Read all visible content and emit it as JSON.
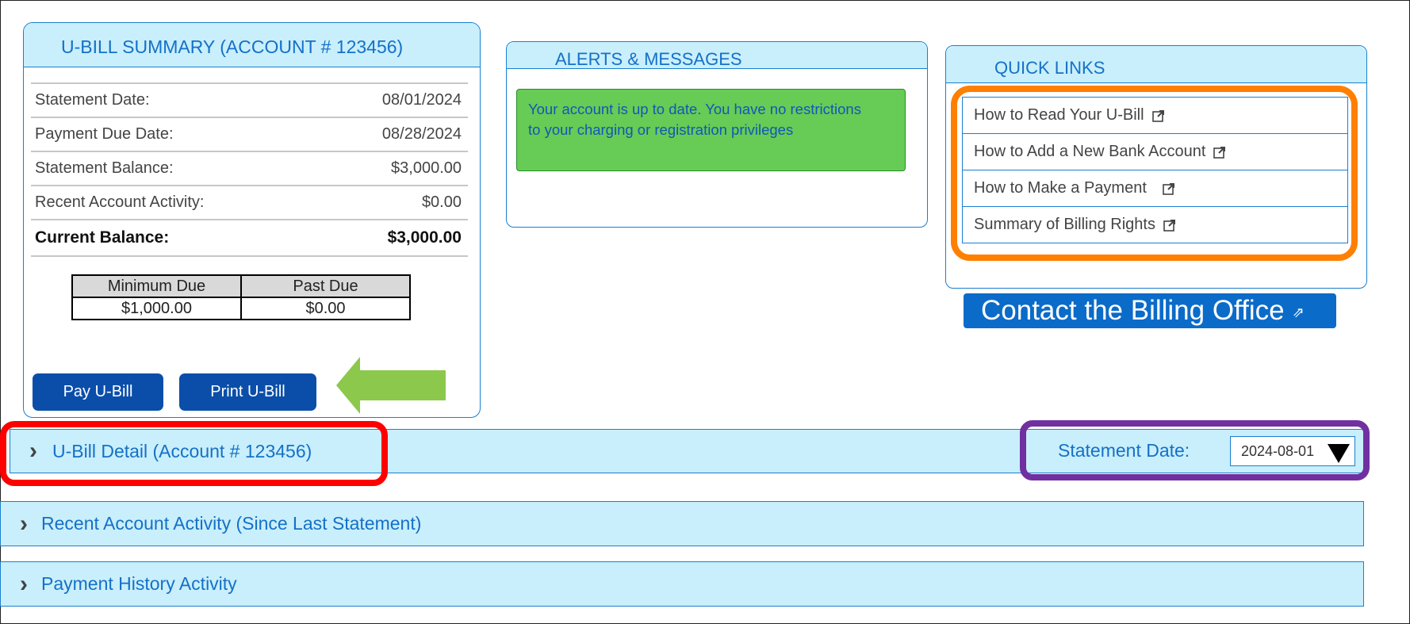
{
  "summary": {
    "title": "U-BILL SUMMARY (ACCOUNT # 123456)",
    "rows": [
      {
        "label": "Statement Date:",
        "value": "08/01/2024"
      },
      {
        "label": "Payment Due Date:",
        "value": "08/28/2024"
      },
      {
        "label": "Statement Balance:",
        "value": "$3,000.00"
      },
      {
        "label": "Recent Account Activity:",
        "value": "$0.00"
      }
    ],
    "total": {
      "label": "Current Balance:",
      "value": "$3,000.00"
    },
    "due_table": {
      "headers": [
        "Minimum Due",
        "Past Due"
      ],
      "values": [
        "$1,000.00",
        "$0.00"
      ]
    },
    "pay_label": "Pay U-Bill",
    "print_label": "Print U-Bill"
  },
  "alerts": {
    "title": "ALERTS & MESSAGES",
    "message_line1": "Your account is up to date. You have no restrictions",
    "message_line2": "to your charging or registration privileges"
  },
  "quick_links": {
    "title": "QUICK LINKS",
    "items": [
      "How to Read Your U-Bill",
      "How to Add a New Bank Account",
      "How to Make a Payment",
      "Summary of Billing Rights"
    ]
  },
  "contact": {
    "label": "Contact the Billing Office"
  },
  "sections": {
    "detail": "U-Bill Detail (Account # 123456)",
    "recent": "Recent Account Activity (Since Last Statement)",
    "history": "Payment History Activity"
  },
  "statement_selector": {
    "label": "Statement Date:",
    "value": "2024-08-01"
  },
  "colors": {
    "header_bg": "#c8effb",
    "accent_blue": "#1670c8",
    "button_blue": "#0b4eaa",
    "alert_green": "#66cc55",
    "highlight_red": "#ff0000",
    "highlight_orange": "#ff7f00",
    "highlight_purple": "#7030a0",
    "arrow_green": "#8cc84b"
  }
}
